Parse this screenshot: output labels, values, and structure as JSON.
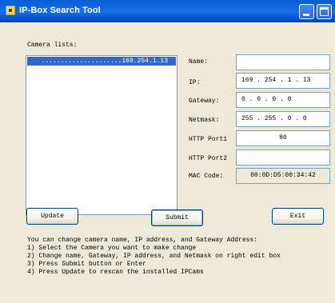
{
  "window": {
    "title": "IP-Box Search Tool"
  },
  "camera_list": {
    "label": "Camera lists:",
    "items": [
      {
        "text": ".....................169.254.1.13",
        "selected": true
      }
    ]
  },
  "fields": {
    "name": {
      "label": "Name:",
      "value": ""
    },
    "ip": {
      "label": "IP:",
      "value": "169 . 254 .  1  . 13"
    },
    "gateway": {
      "label": "Gateway:",
      "value": " 0  .  0  .  0  .  0"
    },
    "netmask": {
      "label": "Netmask:",
      "value": "255 . 255 .  0  .  0"
    },
    "http_port1": {
      "label": "HTTP Port1",
      "value": "80"
    },
    "http_port2": {
      "label": "HTTP Port2",
      "value": ""
    },
    "mac_code": {
      "label": "MAC Code:",
      "value": "00:0D:D5:00:34:42"
    }
  },
  "buttons": {
    "update": "Update",
    "submit": "Submit",
    "exit": "Exit"
  },
  "help": {
    "lines": [
      "You can change camera name, IP address, and Gateway Address:",
      "1) Select the Camera you want to make change",
      "2) Change name, Gateway, IP address, and Netmask on right edit box",
      "3) Press Submit button or Enter",
      "4) Press Update to rescan the installed IPCams"
    ]
  },
  "colors": {
    "titlebar": "#0a5fd8",
    "client_bg": "#ece9d8",
    "selection": "#316ac5"
  },
  "icons": {
    "app": "app-icon",
    "minimize": "minimize-icon",
    "maximize": "maximize-icon"
  }
}
